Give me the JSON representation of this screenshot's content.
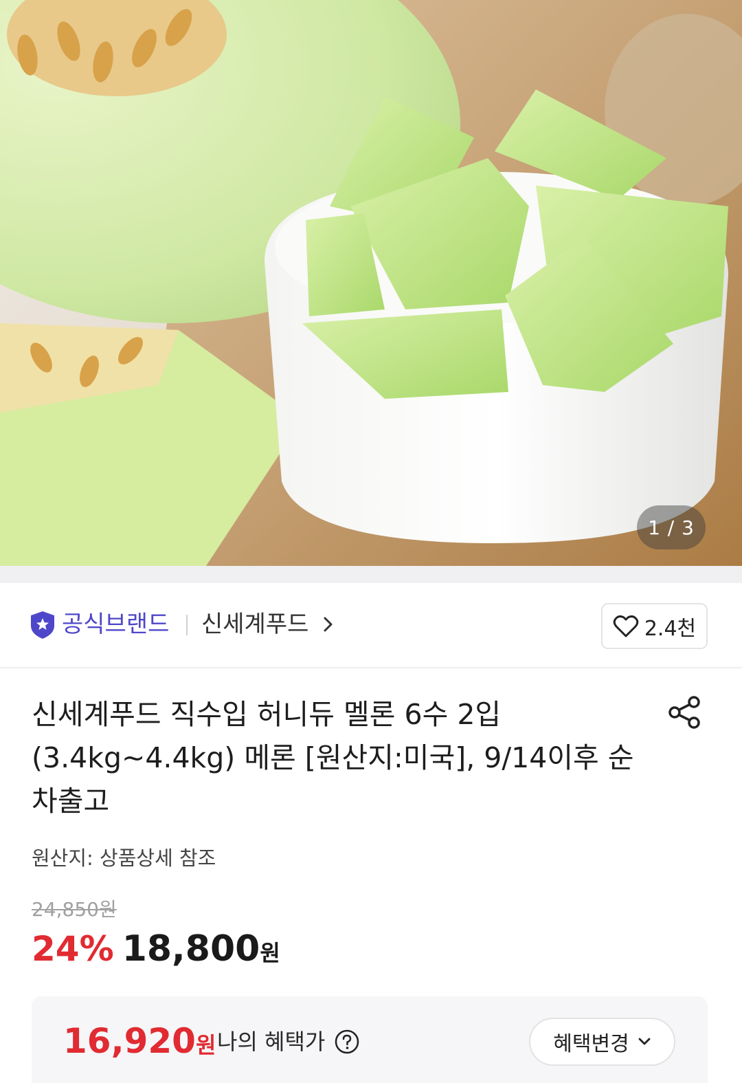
{
  "gallery": {
    "image_alt": "허니듀 멜론",
    "counter": "1 / 3"
  },
  "brand": {
    "official_label": "공식브랜드",
    "name": "신세계푸드",
    "like_count": "2.4천",
    "accent_color": "#4f47c9"
  },
  "product": {
    "title": "신세계푸드 직수입 허니듀 멜론 6수 2입 (3.4kg~4.4kg) 메론 [원산지:미국], 9/14이후 순차출고",
    "origin": "원산지: 상품상세 참조",
    "original_price": "24,850원",
    "discount_rate": "24%",
    "sale_price": "18,800",
    "sale_unit": "원",
    "price_color": "#e12b32"
  },
  "benefit": {
    "amount": "16,920",
    "unit": "원",
    "label": "나의 혜택가",
    "change_label": "혜택변경"
  },
  "icons": {
    "badge": "official-brand-badge-icon",
    "chevron": "chevron-right-icon",
    "like": "heart-icon",
    "share": "share-icon",
    "help": "question-circle-icon",
    "dropdown": "chevron-down-icon"
  }
}
